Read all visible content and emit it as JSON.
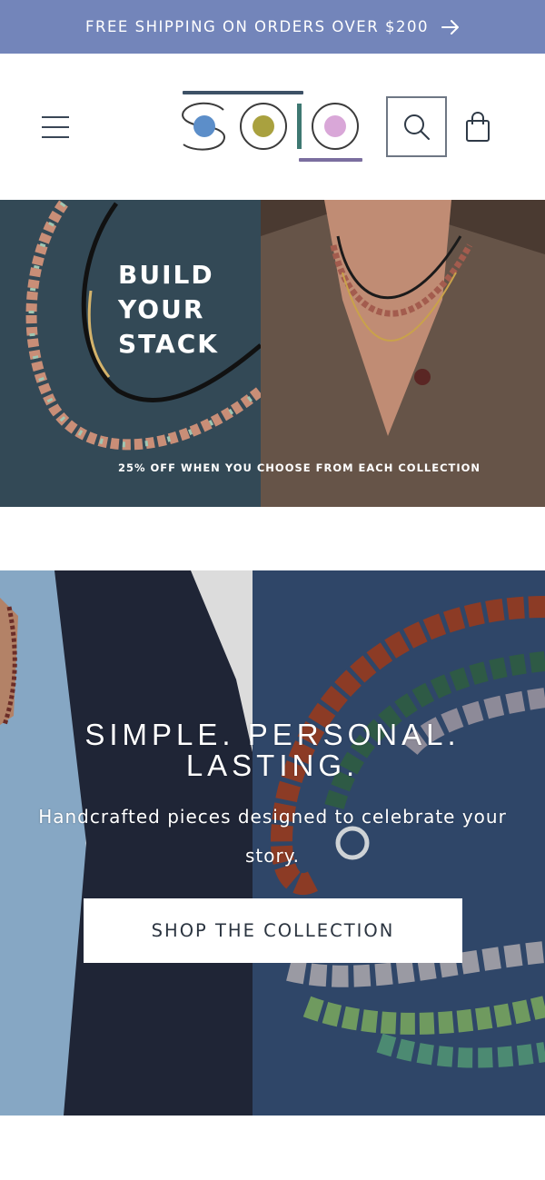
{
  "announcement": {
    "text": "FREE SHIPPING ON ORDERS OVER $200",
    "arrow_icon": "arrow-right-icon",
    "background": "#7385ba"
  },
  "header": {
    "menu_icon": "hamburger-menu-icon",
    "logo_letters": "solo",
    "logo_colors": {
      "dot_blue": "#5c8ec9",
      "dot_olive": "#a9a13f",
      "dot_pink": "#d9a7d8",
      "bar_teal": "#3e7872",
      "bar_purple": "#7b6e9f"
    },
    "search_icon": "search-icon",
    "cart_icon": "shopping-bag-icon"
  },
  "promo": {
    "title_line1": "BUILD",
    "title_line2": "YOUR",
    "title_line3": "STACK",
    "subtitle": "25% OFF WHEN YOU CHOOSE FROM EACH COLLECTION"
  },
  "hero": {
    "headline": "SIMPLE. PERSONAL. LASTING.",
    "text": "Handcrafted pieces designed to celebrate your story.",
    "cta_label": "SHOP THE COLLECTION"
  }
}
